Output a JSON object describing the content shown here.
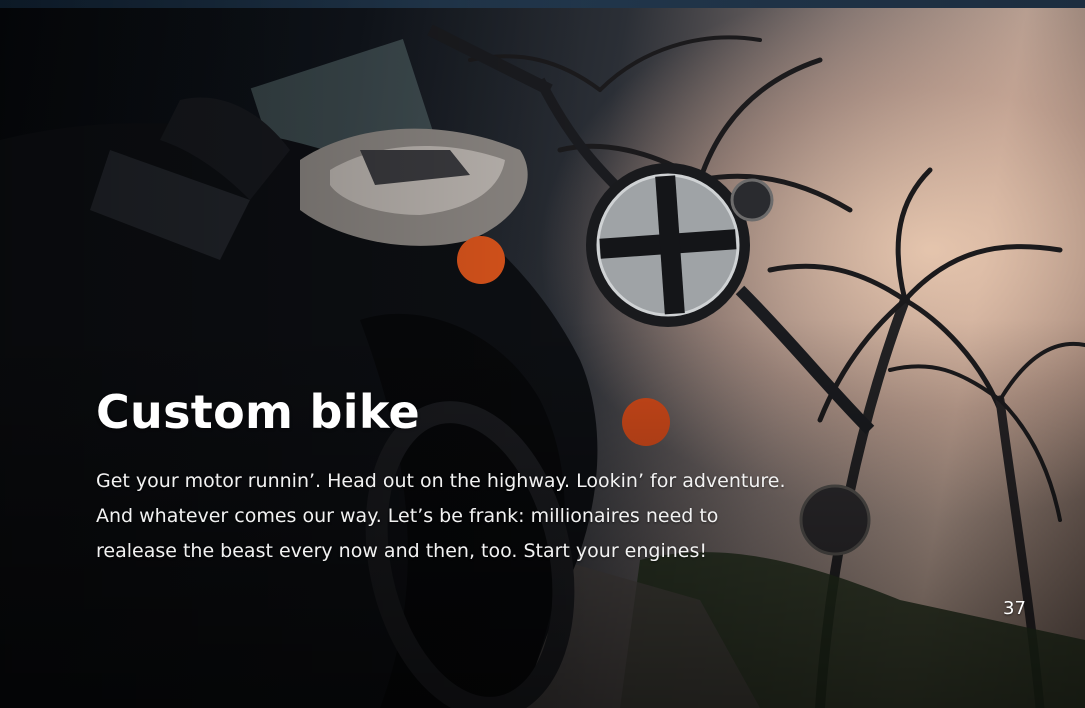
{
  "page": {
    "title": "Custom bike",
    "body_lines": [
      "Get your motor runnin’. Head out on the highway. Lookin’ for adventure.",
      "And whatever comes our way. Let’s be frank: millionaires need to",
      "realease the beast every now and then, too. Start your engines!"
    ],
    "page_number": "37"
  },
  "background": {
    "subject": "motorcycle-at-sunset-with-palm-trees",
    "accent_colors": {
      "sky": "#e8c7b2",
      "indicator_light": "#d9541c",
      "shadow": "#07090d"
    }
  }
}
